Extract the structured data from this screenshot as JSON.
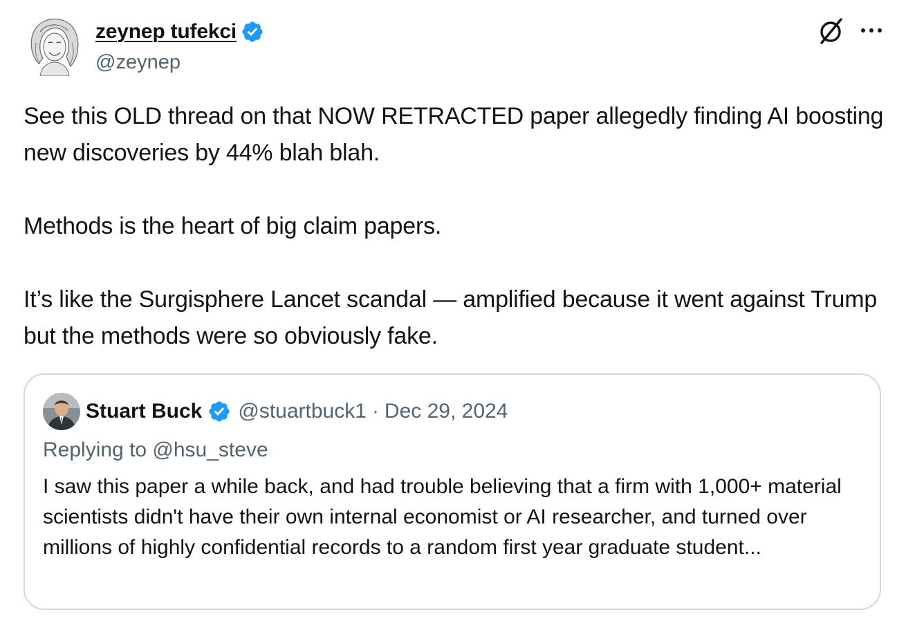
{
  "author": {
    "display_name": "zeynep tufekci",
    "handle": "@zeynep",
    "verified": true
  },
  "header_icons": [
    "grok-icon",
    "more-icon"
  ],
  "tweet": {
    "paragraphs": [
      "See this OLD thread on that NOW RETRACTED paper allegedly finding AI boosting new discoveries by 44% blah blah.",
      "Methods is the heart of big claim papers.",
      "It’s like the Surgisphere Lancet scandal — amplified because it went against Trump but the methods were so obviously fake."
    ]
  },
  "quoted": {
    "display_name": "Stuart Buck",
    "handle": "@stuartbuck1",
    "separator": "·",
    "date": "Dec 29, 2024",
    "replying_to": "Replying to @hsu_steve",
    "text": "I saw this paper a while back, and had trouble believing that a firm with 1,000+ material scientists didn't have their own internal economist or AI researcher, and turned over millions of highly confidential records to a random first year graduate student...",
    "verified": true
  },
  "colors": {
    "text_primary": "#0f1419",
    "text_secondary": "#536471",
    "verified_blue": "#1d9bf0",
    "card_border": "#cfd9de"
  }
}
